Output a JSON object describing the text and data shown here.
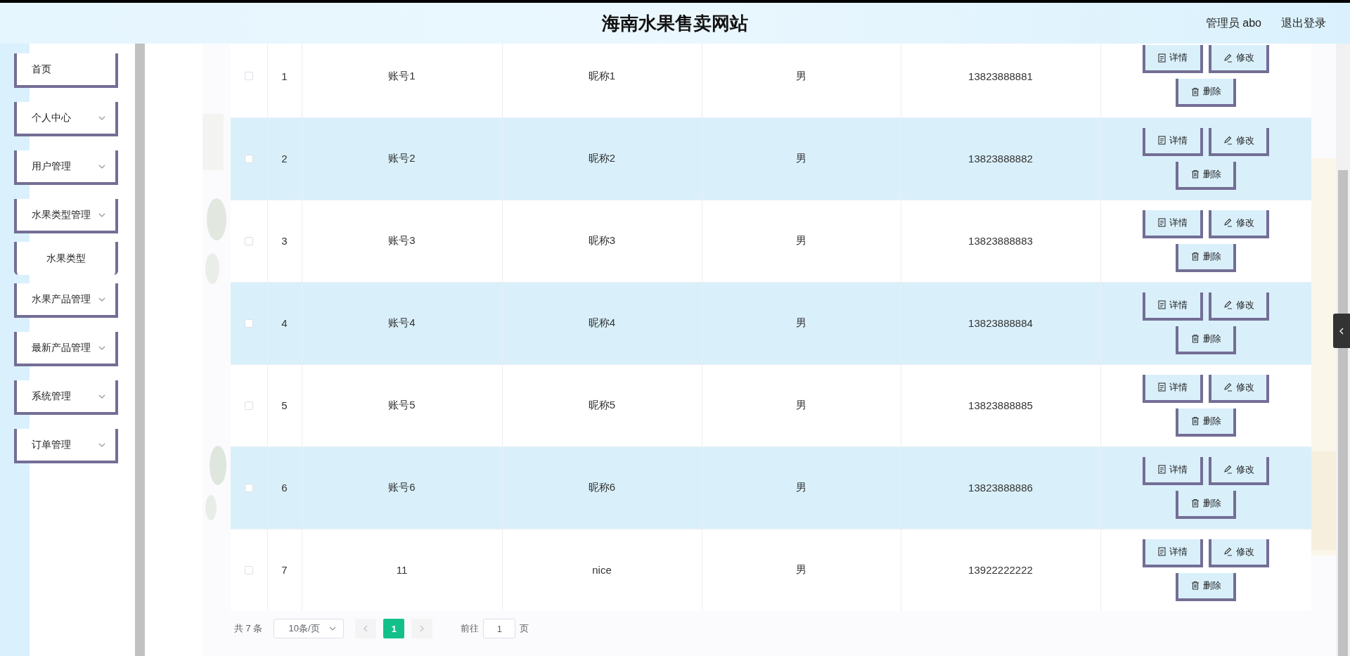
{
  "header": {
    "title": "海南水果售卖网站",
    "user": "管理员 abo",
    "logout": "退出登录"
  },
  "sidebar": {
    "items": [
      {
        "label": "首页",
        "kind": "link"
      },
      {
        "label": "个人中心",
        "kind": "submenu"
      },
      {
        "label": "用户管理",
        "kind": "submenu"
      },
      {
        "label": "水果类型管理",
        "kind": "submenu",
        "children": [
          {
            "label": "水果类型"
          }
        ]
      },
      {
        "label": "水果产品管理",
        "kind": "submenu"
      },
      {
        "label": "最新产品管理",
        "kind": "submenu"
      },
      {
        "label": "系统管理",
        "kind": "submenu"
      },
      {
        "label": "订单管理",
        "kind": "submenu"
      }
    ]
  },
  "table": {
    "rows": [
      {
        "checked": false,
        "index": "1",
        "account": "账号1",
        "nickname": "昵称1",
        "gender": "男",
        "phone": "13823888881",
        "actions": [
          {
            "kind": "detail",
            "label": "详情"
          },
          {
            "kind": "edit",
            "label": "修改"
          },
          {
            "kind": "delete",
            "label": "删除"
          }
        ]
      },
      {
        "checked": false,
        "index": "2",
        "account": "账号2",
        "nickname": "昵称2",
        "gender": "男",
        "phone": "13823888882",
        "actions": [
          {
            "kind": "detail",
            "label": "详情"
          },
          {
            "kind": "edit",
            "label": "修改"
          },
          {
            "kind": "delete",
            "label": "删除"
          }
        ]
      },
      {
        "checked": false,
        "index": "3",
        "account": "账号3",
        "nickname": "昵称3",
        "gender": "男",
        "phone": "13823888883",
        "actions": [
          {
            "kind": "detail",
            "label": "详情"
          },
          {
            "kind": "edit",
            "label": "修改"
          },
          {
            "kind": "delete",
            "label": "删除"
          }
        ]
      },
      {
        "checked": false,
        "index": "4",
        "account": "账号4",
        "nickname": "昵称4",
        "gender": "男",
        "phone": "13823888884",
        "actions": [
          {
            "kind": "detail",
            "label": "详情"
          },
          {
            "kind": "edit",
            "label": "修改"
          },
          {
            "kind": "delete",
            "label": "删除"
          }
        ]
      },
      {
        "checked": false,
        "index": "5",
        "account": "账号5",
        "nickname": "昵称5",
        "gender": "男",
        "phone": "13823888885",
        "actions": [
          {
            "kind": "detail",
            "label": "详情"
          },
          {
            "kind": "edit",
            "label": "修改"
          },
          {
            "kind": "delete",
            "label": "删除"
          }
        ]
      },
      {
        "checked": false,
        "index": "6",
        "account": "账号6",
        "nickname": "昵称6",
        "gender": "男",
        "phone": "13823888886",
        "actions": [
          {
            "kind": "detail",
            "label": "详情"
          },
          {
            "kind": "edit",
            "label": "修改"
          },
          {
            "kind": "delete",
            "label": "删除"
          }
        ]
      },
      {
        "checked": false,
        "index": "7",
        "account": "11",
        "nickname": "nice",
        "gender": "男",
        "phone": "13922222222",
        "actions": [
          {
            "kind": "detail",
            "label": "详情"
          },
          {
            "kind": "edit",
            "label": "修改"
          },
          {
            "kind": "delete",
            "label": "删除"
          }
        ]
      }
    ]
  },
  "pagination": {
    "total": "共 7 条",
    "page_size": "10条/页",
    "pages": [
      {
        "label": "1",
        "selected": true
      }
    ],
    "goto_label": "前往",
    "goto_value": "1",
    "page_suffix": "页"
  }
}
